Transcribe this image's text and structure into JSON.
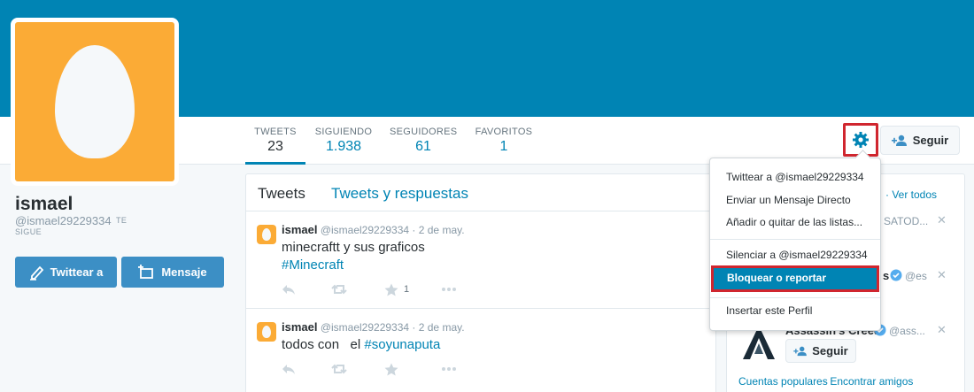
{
  "profile": {
    "name": "ismael",
    "handle": "@ismael29229334",
    "follows_you_1": "TE",
    "follows_you_2": "SIGUE",
    "tweet_button": "Twittear a",
    "message_button": "Mensaje"
  },
  "stats": [
    {
      "label": "TWEETS",
      "value": "23"
    },
    {
      "label": "SIGUIENDO",
      "value": "1.938"
    },
    {
      "label": "SEGUIDORES",
      "value": "61"
    },
    {
      "label": "FAVORITOS",
      "value": "1"
    }
  ],
  "header_actions": {
    "follow_label": "Seguir"
  },
  "timeline": {
    "tabs": [
      "Tweets",
      "Tweets y respuestas"
    ],
    "tweets": [
      {
        "name": "ismael",
        "handle": "@ismael29229334",
        "date": "· 2 de may.",
        "text": "minecraftt y sus graficos",
        "hashtag": "#Minecraft",
        "fav_count": "1"
      },
      {
        "name": "ismael",
        "handle": "@ismael29229334",
        "date": "· 2 de may.",
        "text": "todos con   el",
        "hashtag": "#soyunaputa",
        "fav_count": ""
      }
    ]
  },
  "dropdown": {
    "items": [
      "Twittear a @ismael29229334",
      "Enviar un Mensaje Directo",
      "Añadir o quitar de las listas...",
      "Silenciar a @ismael29229334",
      "Bloquear o reportar",
      "Insertar este Perfil"
    ]
  },
  "sidebar": {
    "view_all": "· Ver todos",
    "peek_1": "SATOD...",
    "peek_2": "s",
    "peek_2_handle": "@es",
    "account_name": "Assassin's Creed",
    "account_handle": "@ass...",
    "follow_label": "Seguir",
    "footer_1": "Cuentas populares",
    "footer_2": "· Encontrar amigos"
  },
  "colors": {
    "banner": "#0084b4",
    "avatar_bg": "#fbab36",
    "highlight_border": "#d0262f",
    "button_blue": "#3c8fc5"
  }
}
